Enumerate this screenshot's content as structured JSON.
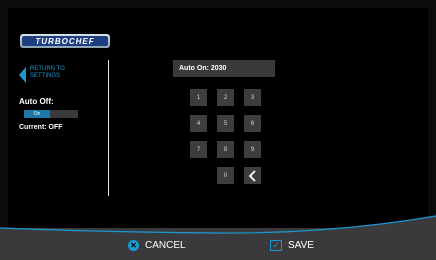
{
  "logo": {
    "text": "TURBOCHEF"
  },
  "sidebar": {
    "return_label": "RETURN TO SETTINGS",
    "auto_off_label": "Auto Off:",
    "toggle_on_label": "On",
    "current_label": "Current: OFF"
  },
  "display": {
    "text": "Auto On:  2030"
  },
  "keypad": {
    "keys": [
      "1",
      "2",
      "3",
      "4",
      "5",
      "6",
      "7",
      "8",
      "9",
      "0"
    ],
    "backspace_icon": "chevron-left-icon"
  },
  "footer": {
    "cancel_label": "CANCEL",
    "save_label": "SAVE"
  },
  "colors": {
    "accent": "#1a99d4",
    "background": "#000000",
    "footer": "#3a3a3d",
    "key": "#3d3d40"
  }
}
